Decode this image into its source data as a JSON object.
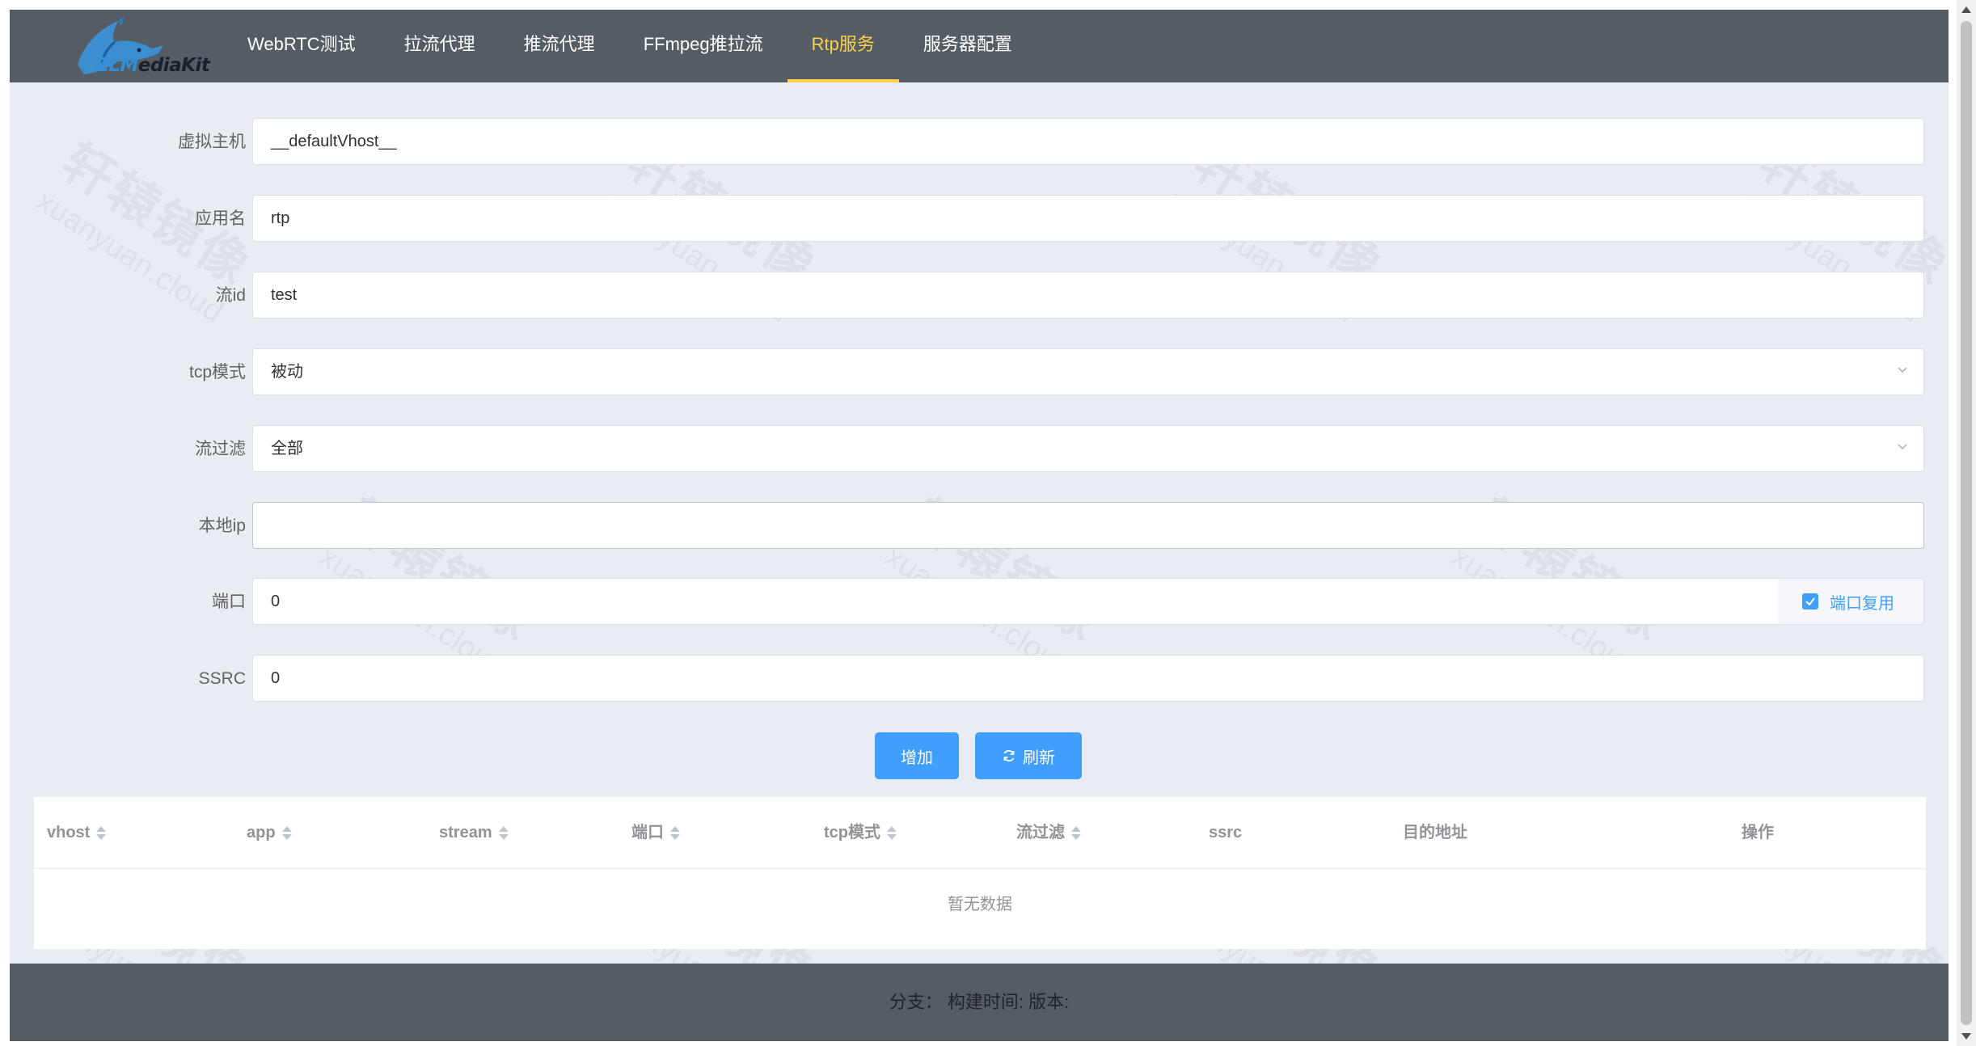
{
  "brand": {
    "logo_text_zl": "ZLM",
    "logo_text_rest": "ediaKit"
  },
  "nav": {
    "items": [
      {
        "label": "WebRTC测试",
        "active": false
      },
      {
        "label": "拉流代理",
        "active": false
      },
      {
        "label": "推流代理",
        "active": false
      },
      {
        "label": "FFmpeg推拉流",
        "active": false
      },
      {
        "label": "Rtp服务",
        "active": true
      },
      {
        "label": "服务器配置",
        "active": false
      }
    ]
  },
  "form": {
    "vhost": {
      "label": "虚拟主机",
      "value": "__defaultVhost__"
    },
    "app": {
      "label": "应用名",
      "value": "rtp"
    },
    "stream_id": {
      "label": "流id",
      "value": "test"
    },
    "tcp_mode": {
      "label": "tcp模式",
      "value": "被动"
    },
    "stream_filter": {
      "label": "流过滤",
      "value": "全部"
    },
    "local_ip": {
      "label": "本地ip",
      "value": ""
    },
    "port": {
      "label": "端口",
      "value": "0",
      "reuse_label": "端口复用",
      "reuse_checked": true
    },
    "ssrc": {
      "label": "SSRC",
      "value": "0"
    }
  },
  "buttons": {
    "add_label": "增加",
    "refresh_label": "刷新"
  },
  "table": {
    "columns": [
      "vhost",
      "app",
      "stream",
      "端口",
      "tcp模式",
      "流过滤",
      "ssrc",
      "目的地址",
      "操作"
    ],
    "empty_text": "暂无数据"
  },
  "footer": {
    "text": "分支： 构建时间: 版本:"
  },
  "watermark": {
    "cn": "轩辕镜像",
    "en": "xuanyuan.cloud"
  },
  "colors": {
    "nav_bg": "#545c64",
    "active": "#ffd04b",
    "primary": "#409eff",
    "page_bg": "#e9edf3"
  }
}
